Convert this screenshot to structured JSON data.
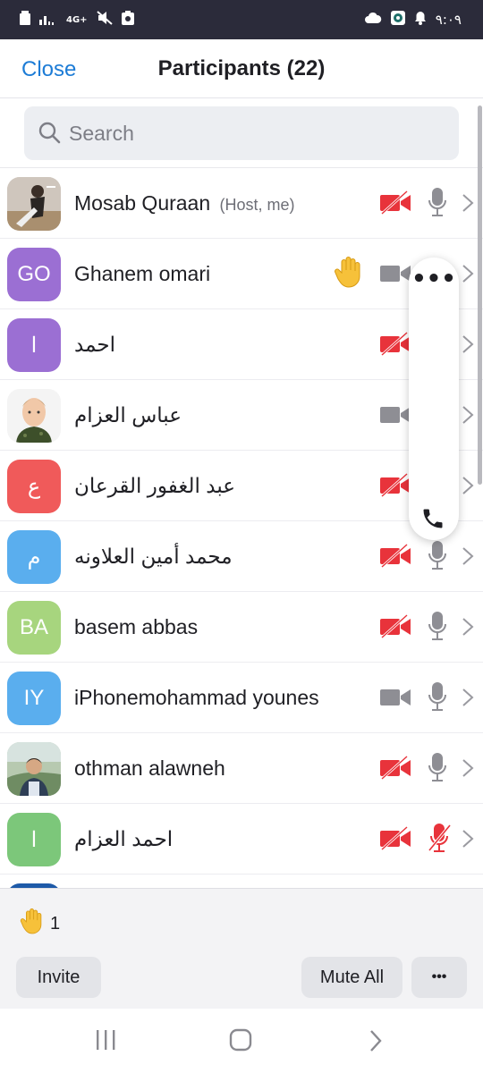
{
  "status_bar": {
    "network": "4G+",
    "time": "٩:٠٩"
  },
  "header": {
    "close_label": "Close",
    "title": "Participants (22)"
  },
  "search": {
    "placeholder": "Search"
  },
  "participants": [
    {
      "name": "Mosab Quraan",
      "tag": "(Host, me)",
      "avatar_type": "photo",
      "video": "off",
      "mic": "on",
      "hand_raised": false
    },
    {
      "name": "Ghanem omari",
      "initials": "GO",
      "avatar_color": "#9b6fd3",
      "video": "on",
      "mic": "hidden",
      "hand_raised": true
    },
    {
      "name": "احمد",
      "initials": "ا",
      "avatar_color": "#9b6fd3",
      "video": "off",
      "mic": "hidden",
      "hand_raised": false
    },
    {
      "name": "عباس العزام",
      "avatar_type": "photo",
      "video": "on",
      "mic": "hidden",
      "hand_raised": false
    },
    {
      "name": "عبد الغفور القرعان",
      "initials": "ع",
      "avatar_color": "#f05a5a",
      "video": "off",
      "mic": "hidden",
      "hand_raised": false
    },
    {
      "name": "محمد أمين العلاونه",
      "initials": "م",
      "avatar_color": "#5aaeee",
      "video": "off",
      "mic": "on",
      "hand_raised": false
    },
    {
      "name": "basem abbas",
      "initials": "BA",
      "avatar_color": "#a7d57e",
      "video": "off",
      "mic": "on",
      "hand_raised": false
    },
    {
      "name": "iPhonemohammad younes",
      "initials": "IY",
      "avatar_color": "#5aaeee",
      "video": "on",
      "mic": "on",
      "hand_raised": false
    },
    {
      "name": "othman alawneh",
      "avatar_type": "photo",
      "video": "off",
      "mic": "on",
      "hand_raised": false
    },
    {
      "name": "احمد العزام",
      "initials": "ا",
      "avatar_color": "#7cc77a",
      "video": "off",
      "mic": "muted",
      "hand_raised": false
    }
  ],
  "bottom": {
    "raised_hands_count": "1",
    "invite_label": "Invite",
    "mute_all_label": "Mute All",
    "more_label": "•••"
  },
  "floating": {
    "more_label": "•••"
  },
  "colors": {
    "accent": "#1d7cd6",
    "video_off": "#e8333b",
    "icon_gray": "#8e8e94",
    "status_bar": "#2b2b3a"
  }
}
